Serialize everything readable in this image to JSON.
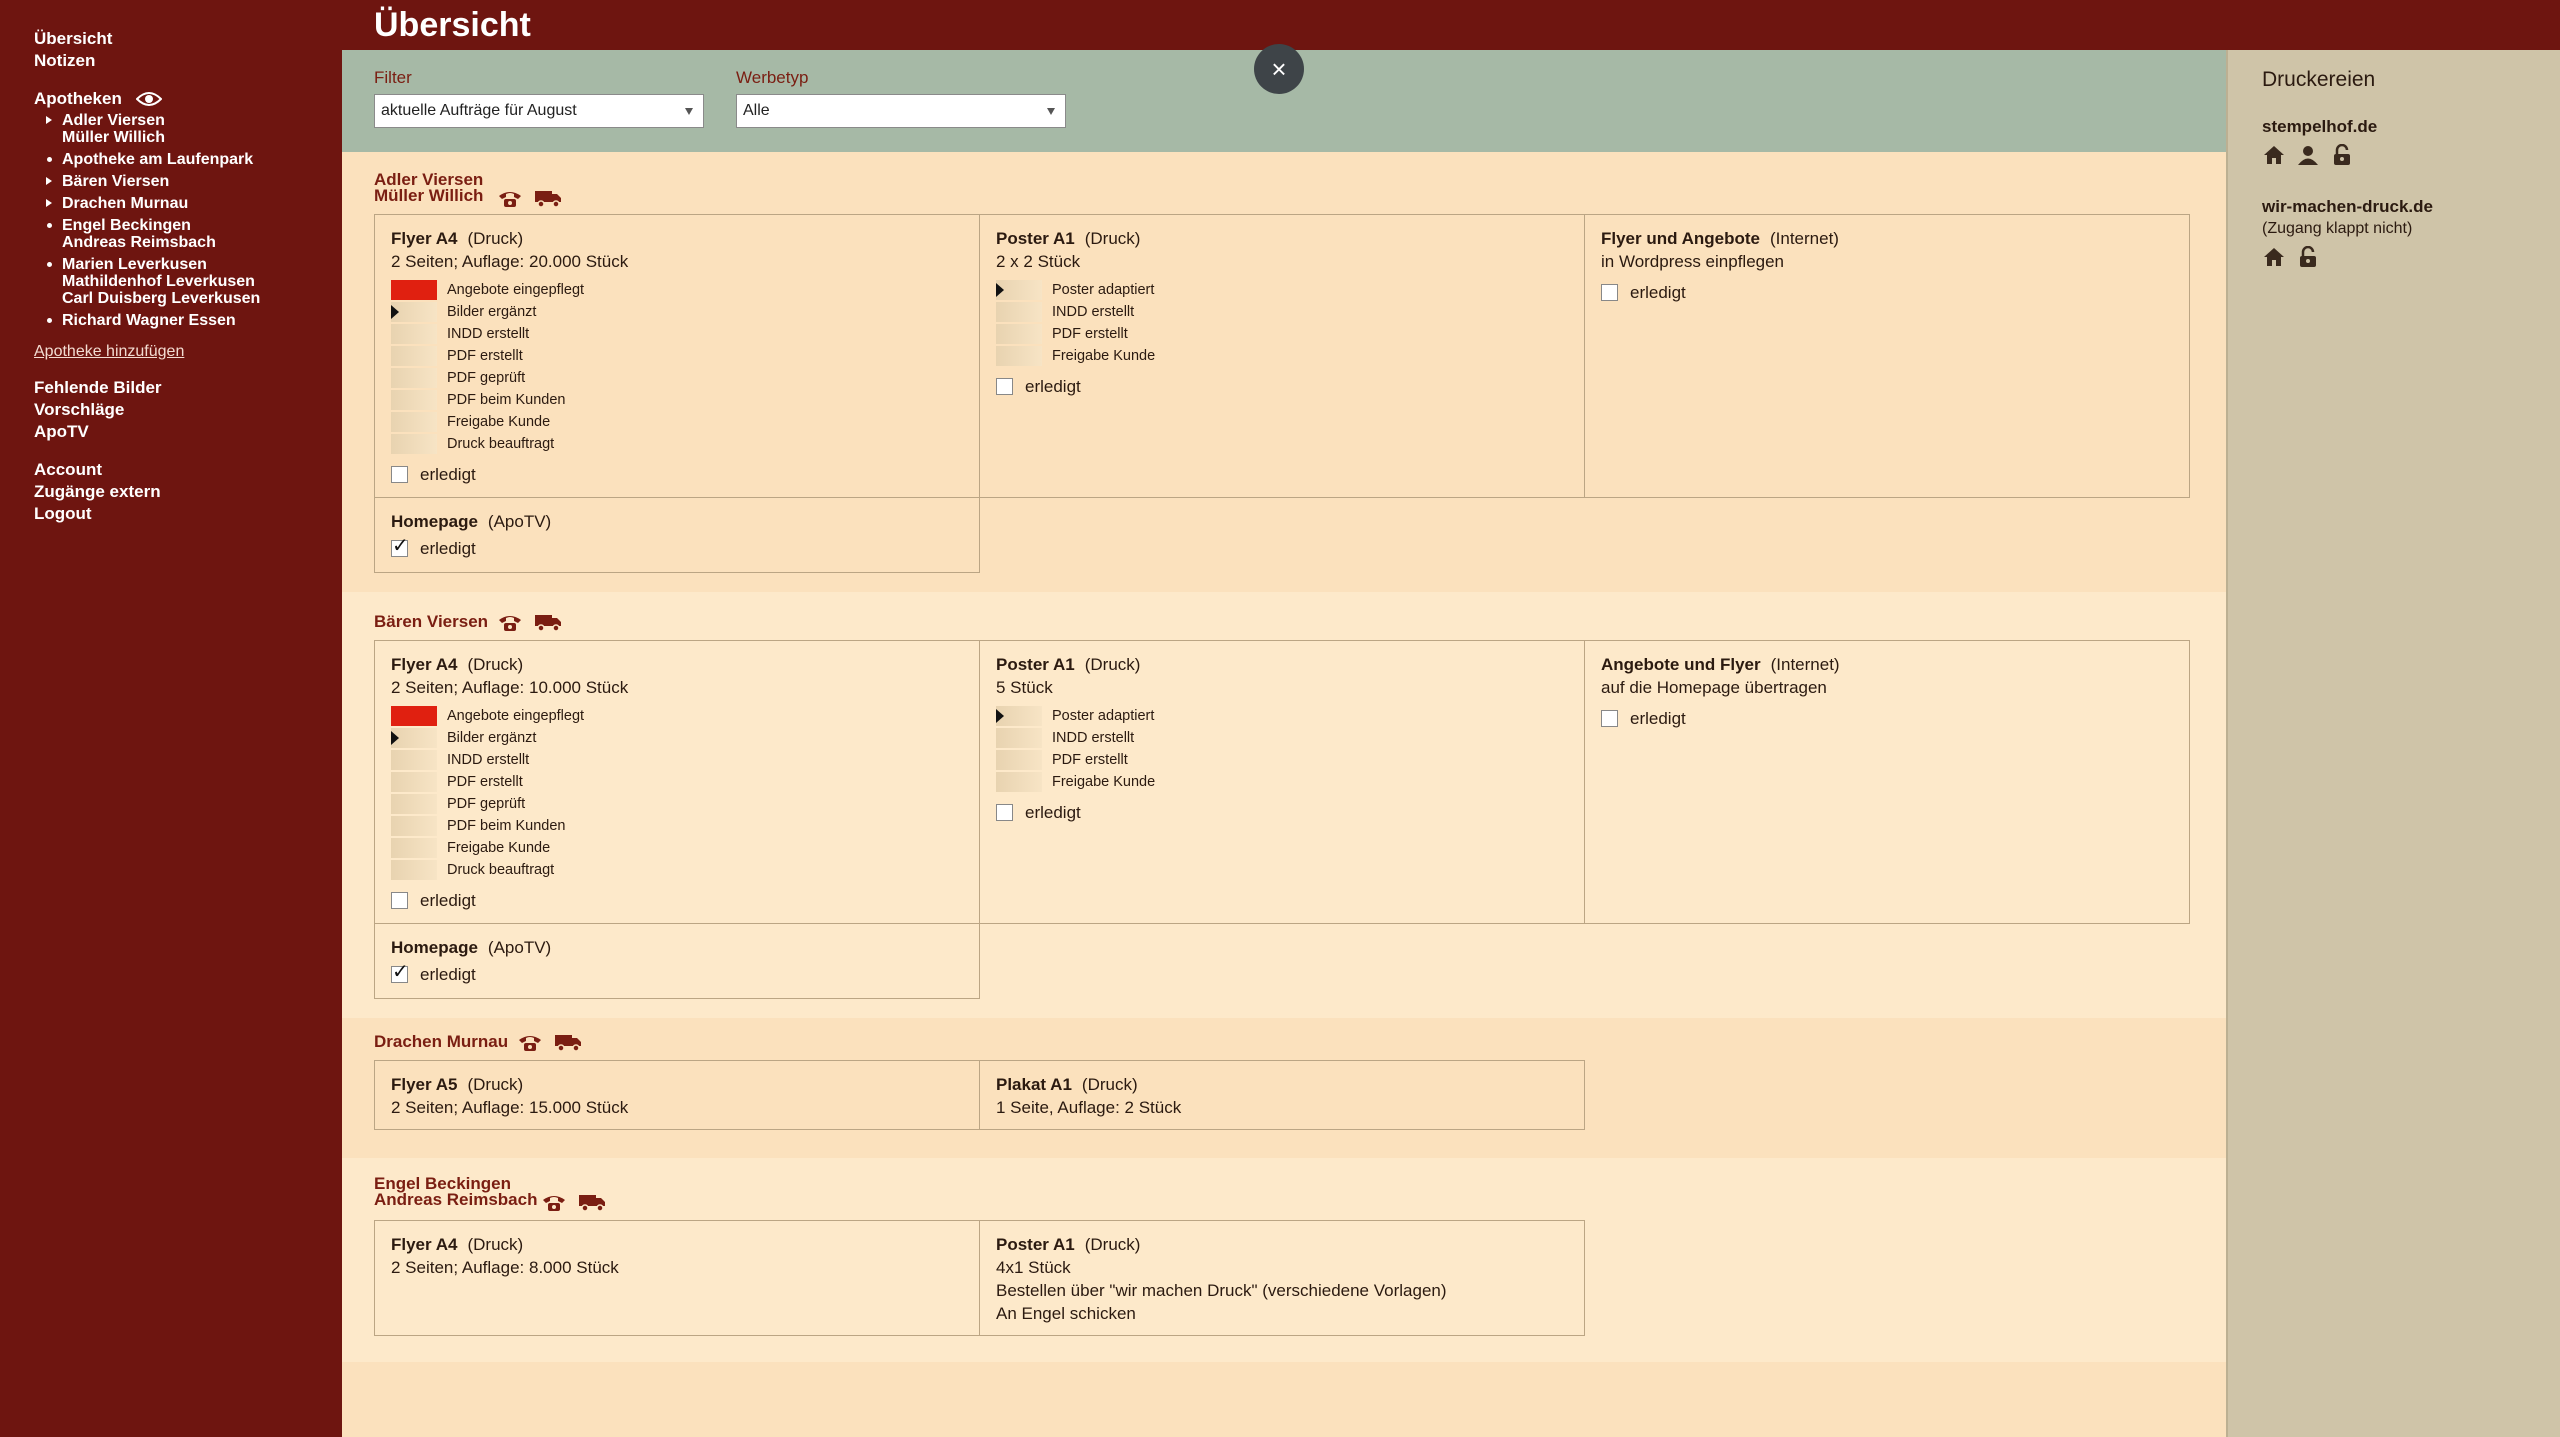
{
  "app": {
    "title": "Übersicht"
  },
  "sidebar": {
    "top_items": [
      "Übersicht",
      "Notizen"
    ],
    "apotheken_label": "Apotheken",
    "apotheken": [
      {
        "marker": "triangle",
        "lines": [
          "Adler Viersen",
          "Müller Willich"
        ]
      },
      {
        "marker": "dot",
        "lines": [
          "Apotheke am Laufenpark"
        ]
      },
      {
        "marker": "triangle",
        "lines": [
          "Bären Viersen"
        ]
      },
      {
        "marker": "triangle",
        "lines": [
          "Drachen Murnau"
        ]
      },
      {
        "marker": "dot",
        "lines": [
          "Engel Beckingen",
          "Andreas Reimsbach"
        ]
      },
      {
        "marker": "dot",
        "lines": [
          "Marien Leverkusen",
          "Mathildenhof Leverkusen",
          "Carl Duisberg Leverkusen"
        ]
      },
      {
        "marker": "dot",
        "lines": [
          "Richard Wagner Essen"
        ]
      }
    ],
    "add_link": "Apotheke hinzufügen",
    "group2": [
      "Fehlende Bilder",
      "Vorschläge",
      "ApoTV"
    ],
    "group3": [
      "Account",
      "Zugänge extern",
      "Logout"
    ]
  },
  "filter": {
    "filter_label": "Filter",
    "filter_value": "aktuelle Aufträge für August",
    "werbetyp_label": "Werbetyp",
    "werbetyp_value": "Alle",
    "close_glyph": "×"
  },
  "right": {
    "title": "Druckereien",
    "printers": [
      {
        "name": "stempelhof.de",
        "note": "",
        "icons": [
          "home-icon",
          "user-icon",
          "lock-icon"
        ]
      },
      {
        "name": "wir-machen-druck.de",
        "note": "(Zugang klappt nicht)",
        "icons": [
          "home-icon",
          "lock-icon"
        ]
      }
    ]
  },
  "steps_print": [
    "Angebote eingepflegt",
    "Bilder ergänzt",
    "INDD erstellt",
    "PDF erstellt",
    "PDF geprüft",
    "PDF beim Kunden",
    "Freigabe Kunde",
    "Druck beauftragt"
  ],
  "steps_poster": [
    "Poster adaptiert",
    "INDD erstellt",
    "PDF erstellt",
    "Freigabe Kunde"
  ],
  "done_label": "erledigt",
  "pharmacies": [
    {
      "name": [
        "Adler Viersen",
        "Müller Willich"
      ],
      "cards": [
        {
          "title": "Flyer A4",
          "type": "(Druck)",
          "details": [
            "2 Seiten; Auflage: 20.000 Stück"
          ]
        },
        {
          "title": "Poster A1",
          "type": "(Druck)",
          "details": [
            "2 x 2 Stück"
          ]
        },
        {
          "title": "Flyer und Angebote",
          "type": "(Internet)",
          "details": [
            "in Wordpress einpflegen"
          ]
        },
        {
          "title": "Homepage",
          "type": "(ApoTV)",
          "details": []
        }
      ]
    },
    {
      "name": [
        "Bären Viersen"
      ],
      "cards": [
        {
          "title": "Flyer A4",
          "type": "(Druck)",
          "details": [
            "2 Seiten; Auflage: 10.000 Stück"
          ]
        },
        {
          "title": "Poster A1",
          "type": "(Druck)",
          "details": [
            "5 Stück"
          ]
        },
        {
          "title": "Angebote und Flyer",
          "type": "(Internet)",
          "details": [
            "auf die Homepage übertragen"
          ]
        },
        {
          "title": "Homepage",
          "type": "(ApoTV)",
          "details": []
        }
      ]
    },
    {
      "name": [
        "Drachen Murnau"
      ],
      "cards": [
        {
          "title": "Flyer A5",
          "type": "(Druck)",
          "details": [
            "2 Seiten; Auflage: 15.000 Stück"
          ]
        },
        {
          "title": "Plakat A1",
          "type": "(Druck)",
          "details": [
            "1 Seite, Auflage: 2 Stück"
          ]
        }
      ]
    },
    {
      "name": [
        "Engel Beckingen",
        "Andreas Reimsbach"
      ],
      "cards": [
        {
          "title": "Flyer A4",
          "type": "(Druck)",
          "details": [
            "2 Seiten; Auflage: 8.000 Stück"
          ]
        },
        {
          "title": "Poster A1",
          "type": "(Druck)",
          "details": [
            "4x1 Stück",
            "Bestellen über \"wir machen Druck\" (verschiedene Vorlagen)",
            "An Engel schicken"
          ]
        }
      ]
    }
  ]
}
